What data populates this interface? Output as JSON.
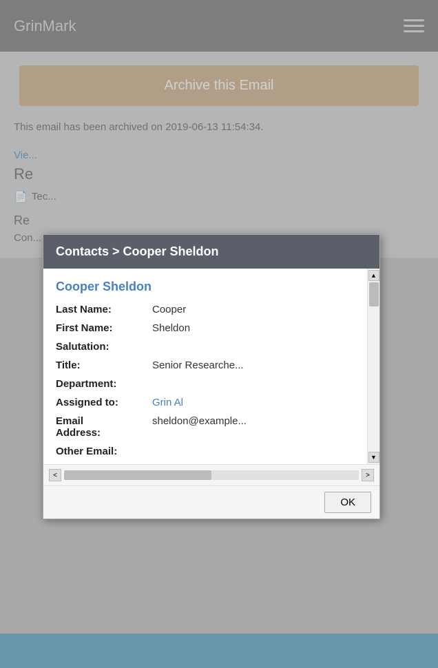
{
  "app": {
    "name": "GrinMark",
    "hamburger_label": "menu"
  },
  "archive_button": {
    "label": "Archive this Email"
  },
  "archived_notice": {
    "text": "This email has been archived on 2019-06-13 11:54:34."
  },
  "view_link": {
    "text": "Vie..."
  },
  "re_heading": {
    "text": "Re"
  },
  "tec_link": {
    "text": "Tec..."
  },
  "re_heading2": {
    "text": "Re"
  },
  "cont_text": {
    "text": "Con..."
  },
  "modal": {
    "breadcrumb": "Contacts > Cooper Sheldon",
    "contact_name": "Cooper Sheldon",
    "fields": [
      {
        "label": "Last Name:",
        "value": "Cooper",
        "type": "text"
      },
      {
        "label": "First Name:",
        "value": "Sheldon",
        "type": "text"
      },
      {
        "label": "Salutation:",
        "value": "",
        "type": "text"
      },
      {
        "label": "Title:",
        "value": "Senior Researche...",
        "type": "text"
      },
      {
        "label": "Department:",
        "value": "",
        "type": "text"
      },
      {
        "label": "Assigned to:",
        "value": "Grin Al",
        "type": "link"
      },
      {
        "label": "Email Address:",
        "value": "sheldon@example...",
        "type": "text"
      },
      {
        "label": "Other Email:",
        "value": "",
        "type": "text"
      }
    ],
    "ok_button": "OK",
    "scroll_up": "▲",
    "scroll_down": "▼",
    "scroll_left": "<",
    "scroll_right": ">"
  }
}
